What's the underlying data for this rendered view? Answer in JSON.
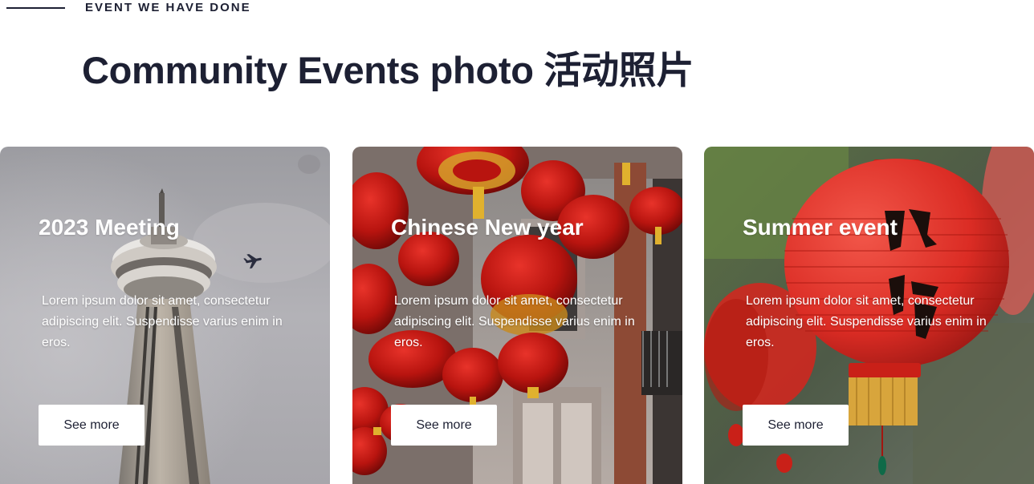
{
  "section": {
    "eyebrow": "EVENT WE HAVE DONE",
    "title": "Community Events photo 活动照片"
  },
  "cards": [
    {
      "title": "2023 Meeting",
      "description": "Lorem ipsum dolor sit amet, consectetur adipiscing elit. Suspendisse varius enim in eros.",
      "button_label": "See more",
      "image": "cn-tower-photo"
    },
    {
      "title": "Chinese New year",
      "description": "Lorem ipsum dolor sit amet, consectetur adipiscing elit. Suspendisse varius enim in eros.",
      "button_label": "See more",
      "image": "red-lanterns-street-photo"
    },
    {
      "title": "Summer event",
      "description": "Lorem ipsum dolor sit amet, consectetur adipiscing elit. Suspendisse varius enim in eros.",
      "button_label": "See more",
      "image": "red-lantern-closeup-photo"
    }
  ],
  "colors": {
    "heading": "#1d2033",
    "button_bg": "#ffffff",
    "card_text": "#ffffff"
  }
}
